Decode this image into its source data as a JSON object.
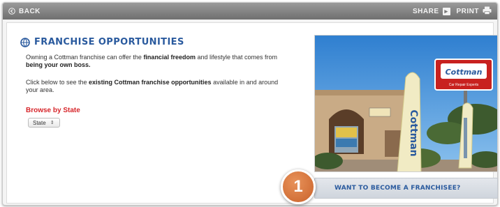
{
  "titlebar": {
    "back_label": "BACK",
    "share_label": "SHARE",
    "print_label": "PRINT"
  },
  "main": {
    "title": "FRANCHISE OPPORTUNITIES",
    "intro": {
      "t1": "Owning a Cottman franchise can offer the ",
      "b1": "financial freedom",
      "t2": " and lifestyle that comes from ",
      "b2": "being your own boss.",
      "t3": ""
    },
    "instructions": {
      "t1": "Click below to see the ",
      "b1": "existing Cottman franchise opportunities",
      "t2": " available in and around your area."
    },
    "browse_label": "Browse by State",
    "state_select": {
      "selected": "State"
    }
  },
  "photo": {
    "sign_brand": "Cottman",
    "sign_tagline": "Car Repair Experts",
    "flag_text": "Cottman"
  },
  "cta": {
    "label": "WANT TO BECOME A FRANCHISEE?"
  },
  "badge": {
    "number": "1"
  },
  "colors": {
    "accent_blue": "#2a5a9e",
    "accent_red": "#d7262b",
    "badge_orange": "#d4733a",
    "titlebar_gray": "#808080"
  },
  "icons": {
    "back": "back-arrow-icon",
    "share": "share-icon",
    "print": "print-icon",
    "logo": "cottman-globe-icon"
  }
}
